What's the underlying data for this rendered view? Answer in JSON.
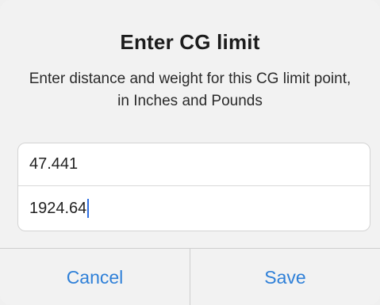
{
  "dialog": {
    "title": "Enter CG limit",
    "message": "Enter distance and weight for this CG limit point, in Inches and Pounds",
    "fields": [
      {
        "value": "47.441"
      },
      {
        "value": "1924.64"
      }
    ],
    "buttons": {
      "cancel_label": "Cancel",
      "save_label": "Save"
    },
    "accent_color": "#2f80d8"
  }
}
